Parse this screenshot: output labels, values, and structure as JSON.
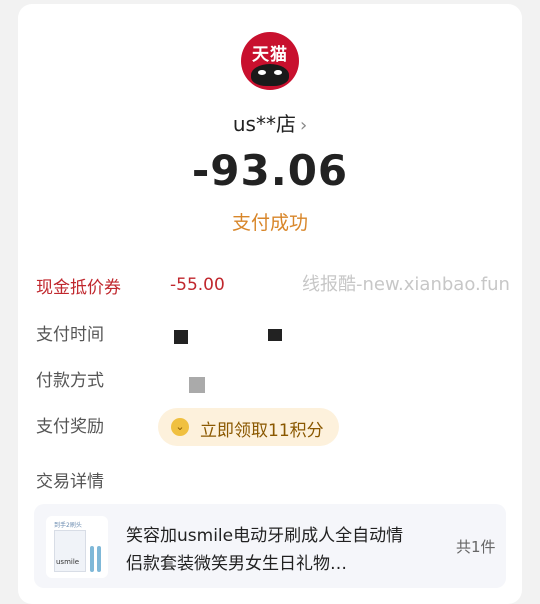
{
  "logo": {
    "text": "天猫",
    "icon": "tmall-cat-icon",
    "brand_color": "#c8102e"
  },
  "merchant": {
    "name": "us**店",
    "chevron": "›"
  },
  "amount": "-93.06",
  "status": "支付成功",
  "status_color": "#d8862a",
  "watermark": "线报酷-new.xianbao.fun",
  "details": {
    "coupon_label": "现金抵价券",
    "coupon_value": "-55.00",
    "pay_time_label": "支付时间",
    "pay_method_label": "付款方式",
    "reward_label": "支付奖励",
    "reward_button": "立即领取11积分",
    "reward_icon": "coin-icon",
    "trade_detail_label": "交易详情"
  },
  "product": {
    "title": "笑容加usmile电动牙刷成人全自动情侣款套装微笑男女生日礼物…",
    "count": "共1件",
    "thumb_brand": "usmile",
    "thumb_tag": "到手2刷头"
  }
}
